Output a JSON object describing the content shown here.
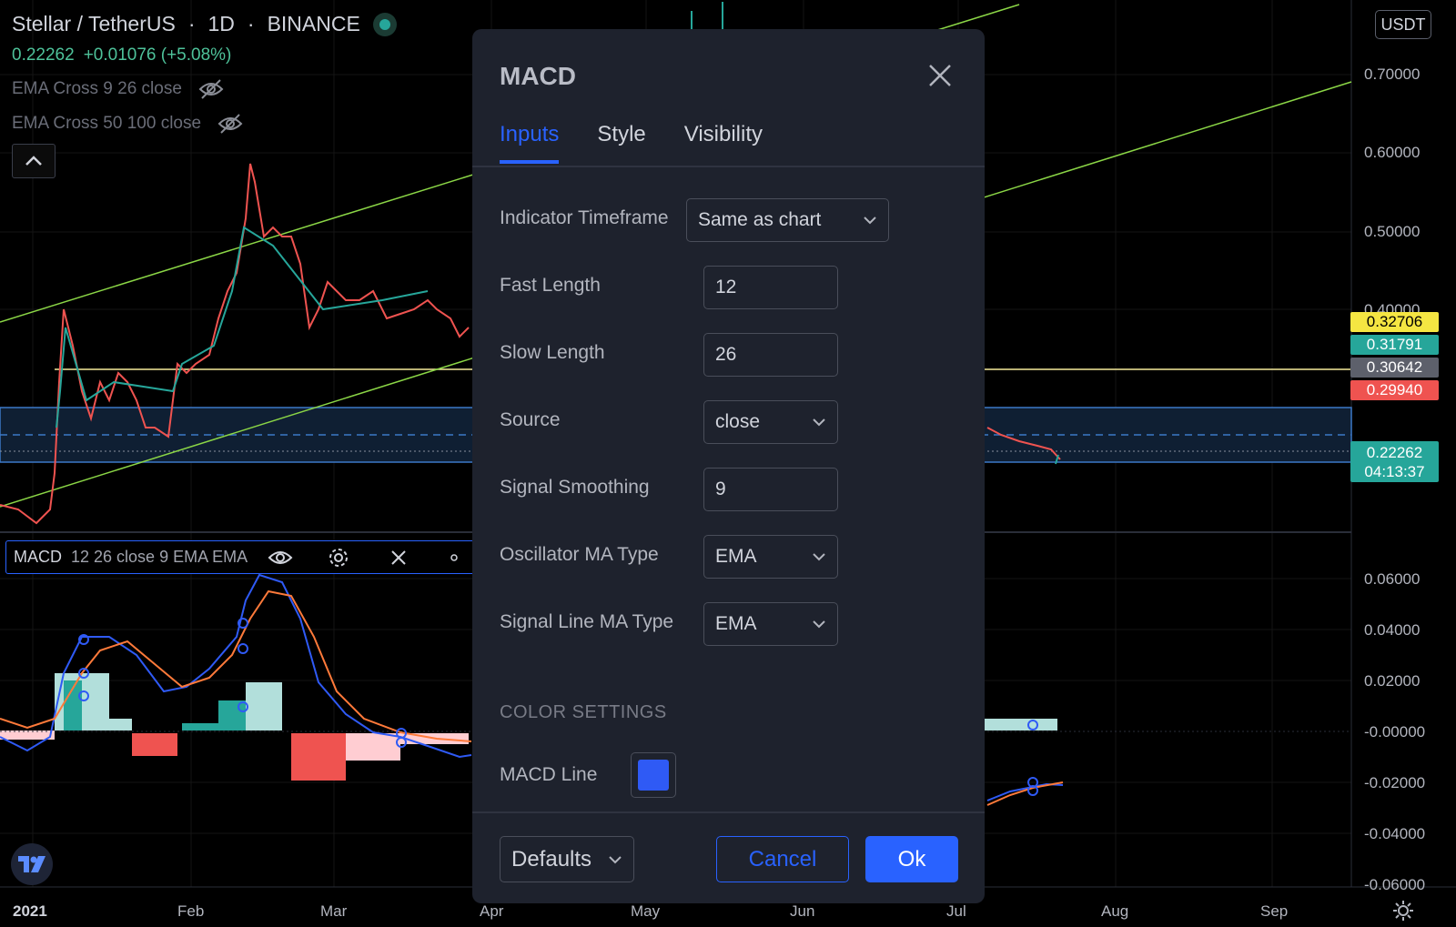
{
  "header": {
    "symbol": "Stellar / TetherUS",
    "interval": "1D",
    "exchange": "BINANCE",
    "price": "0.22262",
    "change": "+0.01076 (+5.08%)",
    "indicators": [
      "EMA Cross 9 26 close",
      "EMA Cross 50 100 close"
    ]
  },
  "currency_button": "USDT",
  "price_axis": [
    "0.70000",
    "0.60000",
    "0.50000",
    "0.40000",
    "0.06000",
    "0.04000",
    "0.02000",
    "-0.00000",
    "-0.02000",
    "-0.04000",
    "-0.06000"
  ],
  "price_tags": [
    {
      "value": "0.32706",
      "bg": "#f5e642",
      "fg": "#000000"
    },
    {
      "value": "0.31791",
      "bg": "#26a69a",
      "fg": "#ffffff"
    },
    {
      "value": "0.30642",
      "bg": "#5d606b",
      "fg": "#ffffff"
    },
    {
      "value": "0.29940",
      "bg": "#ef5350",
      "fg": "#ffffff"
    }
  ],
  "last_price": {
    "value": "0.22262",
    "countdown": "04:13:37",
    "bg": "#26a69a"
  },
  "time_axis": [
    "2021",
    "Feb",
    "Mar",
    "Apr",
    "May",
    "Jun",
    "Jul",
    "Aug",
    "Sep"
  ],
  "macd_legend": {
    "name": "MACD",
    "params": "12 26 close 9 EMA EMA"
  },
  "dialog": {
    "title": "MACD",
    "tabs": [
      {
        "label": "Inputs",
        "active": true
      },
      {
        "label": "Style",
        "active": false
      },
      {
        "label": "Visibility",
        "active": false
      }
    ],
    "fields": {
      "timeframe": {
        "label": "Indicator Timeframe",
        "value": "Same as chart"
      },
      "fast": {
        "label": "Fast Length",
        "value": "12"
      },
      "slow": {
        "label": "Slow Length",
        "value": "26"
      },
      "source": {
        "label": "Source",
        "value": "close"
      },
      "signal": {
        "label": "Signal Smoothing",
        "value": "9"
      },
      "osc_ma": {
        "label": "Oscillator MA Type",
        "value": "EMA"
      },
      "sig_ma": {
        "label": "Signal Line MA Type",
        "value": "EMA"
      }
    },
    "color_section": "COLOR SETTINGS",
    "macd_line": {
      "label": "MACD Line",
      "color": "#2f5af5"
    },
    "defaults": "Defaults",
    "cancel": "Cancel",
    "ok": "Ok"
  },
  "colors": {
    "up": "#26a69a",
    "down": "#ef5350",
    "channel": "#8bd646",
    "hline": "#f5eb9b",
    "macd": "#2f5af5",
    "signal": "#ff7a3a",
    "accent": "#2962ff"
  }
}
